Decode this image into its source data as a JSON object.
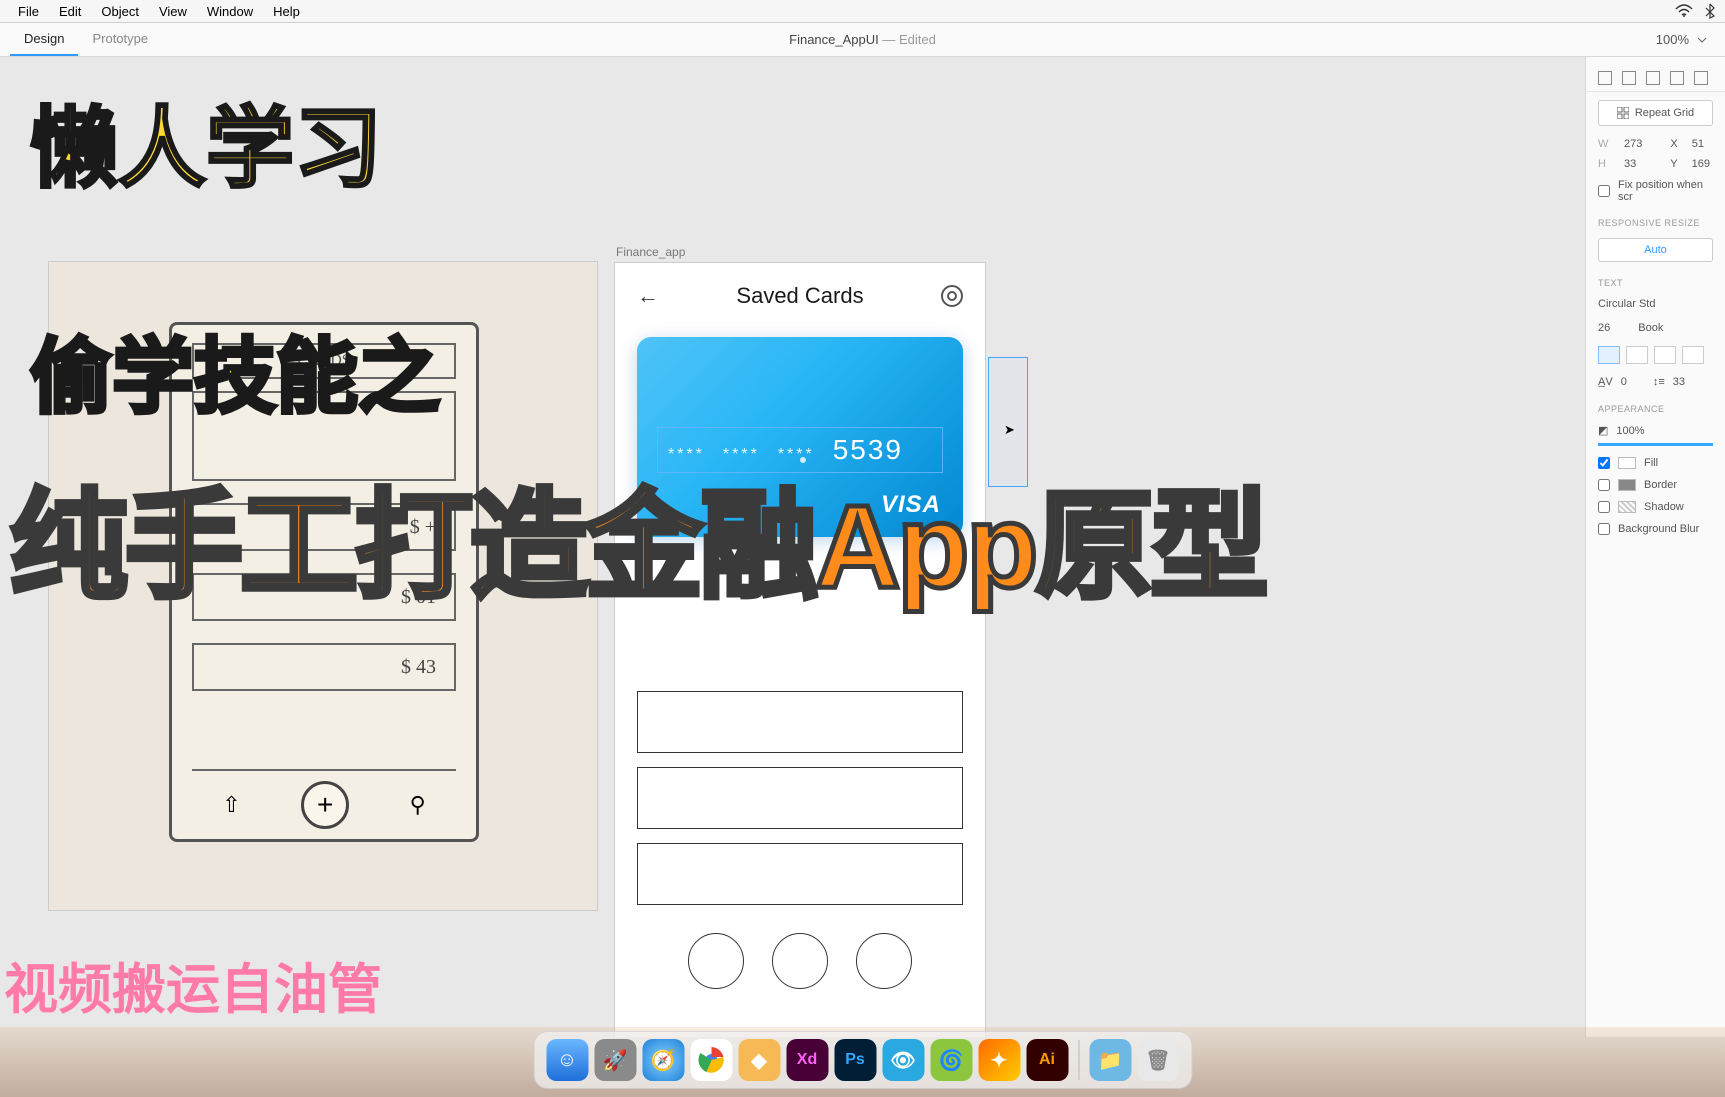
{
  "menubar": {
    "items": [
      "File",
      "Edit",
      "Object",
      "View",
      "Window",
      "Help"
    ]
  },
  "tabs": {
    "design": "Design",
    "prototype": "Prototype",
    "doc": "Finance_AppUI",
    "edited": "— Edited",
    "zoom": "100%"
  },
  "artboard": {
    "label": "Finance_app",
    "title": "Saved Cards",
    "card": {
      "mask": "****",
      "last4": "5539",
      "brand": "VISA"
    }
  },
  "sketch": {
    "row1": "$ +",
    "row2": "$ 01",
    "row3": "$ 43"
  },
  "inspector": {
    "repeat_grid": "Repeat Grid",
    "w": "273",
    "h": "33",
    "x": "51",
    "y": "169",
    "fix_position": "Fix position when scr",
    "responsive": "RESPONSIVE RESIZE",
    "auto": "Auto",
    "text_label": "TEXT",
    "font": "Circular Std",
    "font_size": "26",
    "font_weight": "Book",
    "char_spacing": "0",
    "line_spacing": "33",
    "appearance": "APPEARANCE",
    "opacity": "100%",
    "fill": "Fill",
    "border": "Border",
    "shadow": "Shadow",
    "bgblur": "Background Blur"
  },
  "overlay": {
    "line1": "懒人学习",
    "line2": "偷学技能之",
    "line3": "纯手工打造金融App原型",
    "line4": "视频搬运自油管"
  },
  "dock": {
    "xd": "Xd",
    "ps": "Ps",
    "ai": "Ai"
  }
}
